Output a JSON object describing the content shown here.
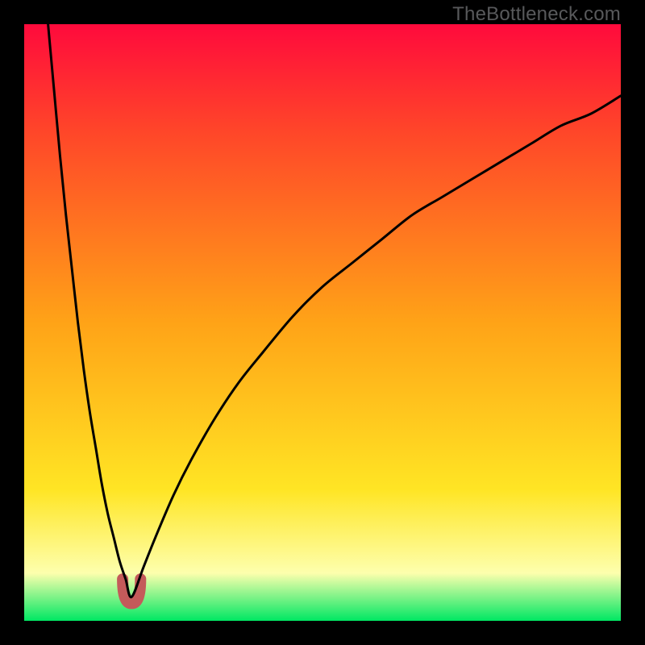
{
  "watermark": "TheBottleneck.com",
  "colors": {
    "frame": "#000000",
    "gradient_top": "#ff0a3c",
    "gradient_upper_mid": "#ff4629",
    "gradient_mid": "#ffa317",
    "gradient_lower_mid": "#ffe524",
    "gradient_pale": "#fdffad",
    "gradient_bottom": "#00e763",
    "curve": "#000000",
    "valley_marker": "#c45a5a"
  },
  "chart_data": {
    "type": "line",
    "title": "",
    "xlabel": "",
    "ylabel": "",
    "xlim": [
      0,
      100
    ],
    "ylim": [
      0,
      100
    ],
    "grid": false,
    "legend": false,
    "notes": "Bottleneck-style cusp curve. x is a normalized component ratio (0–100). y is bottleneck percentage (0–100). The minimum (≈0%) occurs near x≈18; the left branch rises steeply toward 100% as x→0, the right branch rises slowly toward ~88% as x→100. A short pink U-shaped marker highlights the valley near y≈4–7.",
    "series": [
      {
        "name": "left_branch",
        "x": [
          4,
          5,
          6,
          7,
          8,
          9,
          10,
          11,
          12,
          13,
          14,
          15,
          16,
          17,
          18
        ],
        "values": [
          100,
          89,
          78,
          68,
          59,
          50,
          42,
          35,
          29,
          23,
          18,
          14,
          10,
          7,
          4
        ]
      },
      {
        "name": "right_branch",
        "x": [
          18,
          20,
          22,
          25,
          28,
          32,
          36,
          40,
          45,
          50,
          55,
          60,
          65,
          70,
          75,
          80,
          85,
          90,
          95,
          100
        ],
        "values": [
          4,
          9,
          14,
          21,
          27,
          34,
          40,
          45,
          51,
          56,
          60,
          64,
          68,
          71,
          74,
          77,
          80,
          83,
          85,
          88
        ]
      }
    ],
    "valley_marker": {
      "x_range": [
        16.5,
        19.5
      ],
      "y_range": [
        4,
        7
      ]
    }
  }
}
